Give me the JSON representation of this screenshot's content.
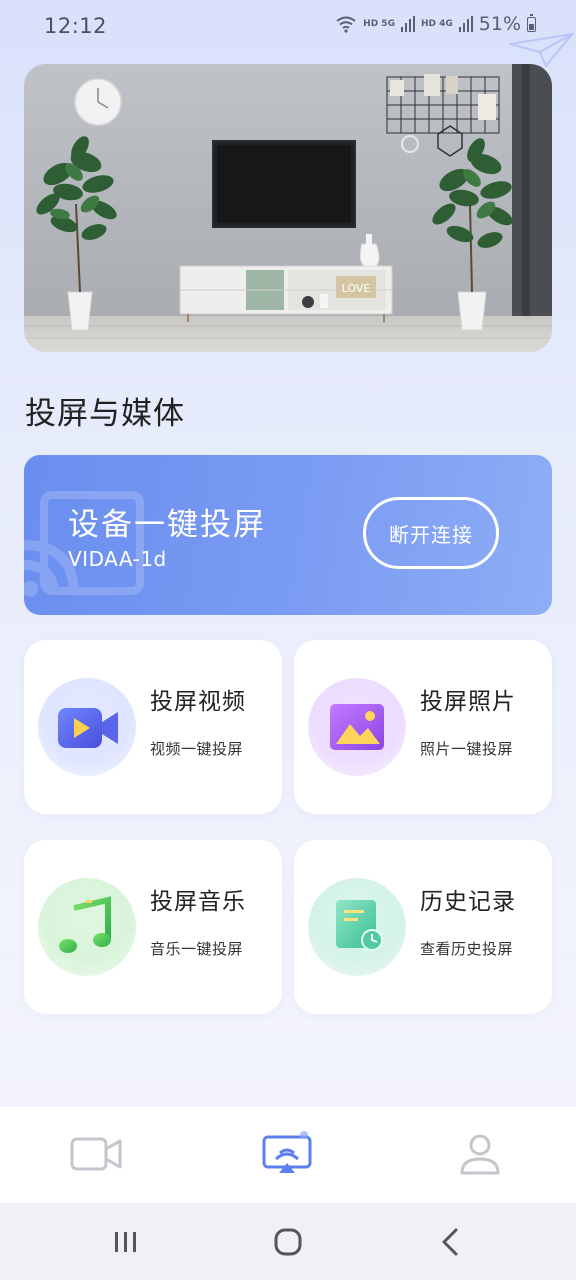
{
  "status_bar": {
    "time": "12:12",
    "network_1": "HD 5G",
    "network_2": "HD 4G",
    "battery": "51%"
  },
  "hero": {
    "description_icon": "living-room-tv-illustration",
    "decor_sign_text": "LOVE"
  },
  "section_title": "投屏与媒体",
  "cast_banner": {
    "title": "设备一键投屏",
    "device_name": "VIDAA-1d",
    "disconnect_label": "断开连接"
  },
  "features": [
    {
      "title": "投屏视频",
      "subtitle": "视频一键投屏",
      "icon": "video-camera-icon",
      "color": "#5a6cf0"
    },
    {
      "title": "投屏照片",
      "subtitle": "照片一键投屏",
      "icon": "image-icon",
      "color": "#a257f0"
    },
    {
      "title": "投屏音乐",
      "subtitle": "音乐一键投屏",
      "icon": "music-note-icon",
      "color": "#3ec35a"
    },
    {
      "title": "历史记录",
      "subtitle": "查看历史投屏",
      "icon": "history-document-icon",
      "color": "#3cc59a"
    }
  ],
  "bottom_nav": {
    "items": [
      {
        "icon": "video-camera-outline-icon",
        "active": false
      },
      {
        "icon": "screen-cast-icon",
        "active": true
      },
      {
        "icon": "user-profile-icon",
        "active": false
      }
    ],
    "active_color": "#5b7ff0",
    "inactive_color": "#c4c6cd"
  },
  "system_nav": {
    "items": [
      "recent-apps-icon",
      "home-icon",
      "back-icon"
    ]
  }
}
